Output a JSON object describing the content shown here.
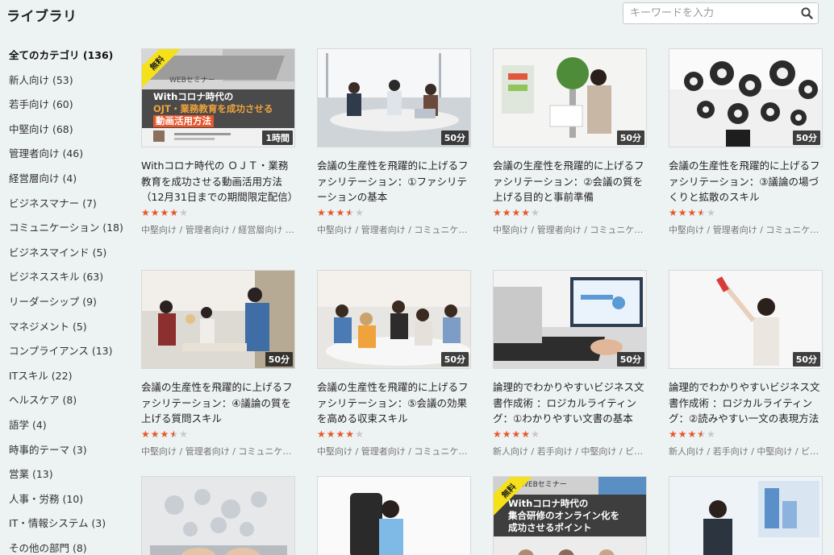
{
  "page": {
    "title": "ライブラリ"
  },
  "search": {
    "placeholder": "キーワードを入力"
  },
  "categories": [
    "全てのカテゴリ (136)",
    "新人向け (53)",
    "若手向け (60)",
    "中堅向け (68)",
    "管理者向け (46)",
    "経営層向け (4)",
    "ビジネスマナー (7)",
    "コミュニケーション (18)",
    "ビジネスマインド (5)",
    "ビジネススキル (63)",
    "リーダーシップ (9)",
    "マネジメント (5)",
    "コンプライアンス (13)",
    "ITスキル (22)",
    "ヘルスケア (8)",
    "語学 (4)",
    "時事的テーマ (3)",
    "営業 (13)",
    "人事・労務 (10)",
    "IT・情報システム (3)",
    "その他の部門 (8)"
  ],
  "cards": [
    {
      "title": "Withコロナ時代の ＯＪＴ・業務教育を成功させる動画活用方法 （12月31日までの期間限定配信）",
      "duration": "1時間",
      "rating": 4,
      "tags": "中堅向け / 管理者向け / 経営層向け / …",
      "badge": "無料",
      "promo": {
        "small": "WEBセミナー",
        "line1": "Withコロナ時代の",
        "line2": "OJT・業務教育を成功させる",
        "line3": "動画活用方法"
      }
    },
    {
      "title": "会議の生産性を飛躍的に上げるファシリテーション：①ファシリテーションの基本",
      "duration": "50分",
      "rating": 3.5,
      "tags": "中堅向け / 管理者向け / コミュニケ…"
    },
    {
      "title": "会議の生産性を飛躍的に上げるファシリテーション：②会議の質を上げる目的と事前準備",
      "duration": "50分",
      "rating": 4,
      "tags": "中堅向け / 管理者向け / コミュニケ…"
    },
    {
      "title": "会議の生産性を飛躍的に上げるファシリテーション：③議論の場づくりと拡散のスキル",
      "duration": "50分",
      "rating": 3.5,
      "tags": "中堅向け / 管理者向け / コミュニケ…"
    },
    {
      "title": "会議の生産性を飛躍的に上げるファシリテーション：④議論の質を上げる質問スキル",
      "duration": "50分",
      "rating": 3.5,
      "tags": "中堅向け / 管理者向け / コミュニケ…"
    },
    {
      "title": "会議の生産性を飛躍的に上げるファシリテーション：⑤会議の効果を高める収束スキル",
      "duration": "50分",
      "rating": 4,
      "tags": "中堅向け / 管理者向け / コミュニケ…"
    },
    {
      "title": "論理的でわかりやすいビジネス文書作成術 ：ロジカルライティング：①わかりやすい文書の基本",
      "duration": "50分",
      "rating": 4,
      "tags": "新人向け / 若手向け / 中堅向け / ビジ…"
    },
    {
      "title": "論理的でわかりやすいビジネス文書作成術 ：ロジカルライティング：②読みやすい一文の表現方法",
      "duration": "50分",
      "rating": 3.5,
      "tags": "新人向け / 若手向け / 中堅向け / ビジ…"
    },
    {
      "title": "",
      "duration": "",
      "rating": 0,
      "tags": ""
    },
    {
      "title": "",
      "duration": "",
      "rating": 0,
      "tags": ""
    },
    {
      "title": "",
      "duration": "",
      "rating": 0,
      "tags": "",
      "badge": "無料",
      "promo": {
        "small": "WEBセミナー",
        "line1": "Withコロナ時代の",
        "line2": "集合研修のオンライン化を",
        "line3": "成功させるポイント"
      }
    },
    {
      "title": "",
      "duration": "",
      "rating": 0,
      "tags": ""
    }
  ],
  "colors": {
    "background": "#edf2f2",
    "star_on": "#e8562a",
    "star_off": "#c8c8c8",
    "badge": "#f4e11a",
    "promo_bar": "#e8562a"
  }
}
